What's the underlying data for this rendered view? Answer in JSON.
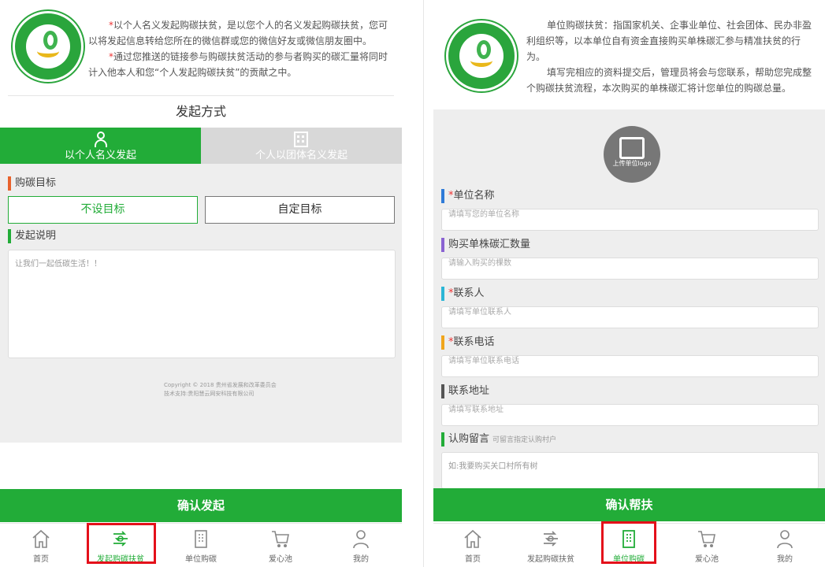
{
  "left": {
    "intro": [
      {
        "star": "*",
        "text": "以个人名义发起购碳扶贫，是以您个人的名义发起购碳扶贫，您可以将发起信息转给您所在的微信群或您的微信好友或微信朋友圈中。"
      },
      {
        "star": "*",
        "text": "通过您推送的链接参与购碳扶贫活动的参与者购买的碳汇量将同时计入他本人和您“个人发起购碳扶贫”的贡献之中。"
      }
    ],
    "section_title": "发起方式",
    "mode_tabs": [
      {
        "label": "以个人名义发起",
        "icon": "person-icon"
      },
      {
        "label": "个人以团体名义发起",
        "icon": "building-icon"
      }
    ],
    "goal_label": "购碳目标",
    "goal_buttons": [
      "不设目标",
      "自定目标"
    ],
    "desc_label": "发起说明",
    "desc_placeholder": "让我们一起低碳生活！！",
    "footer": {
      "copyright": "Copyright © 2018 贵州省发展和改革委员会",
      "support": "技术支持:贵阳慧云网安科技有限公司"
    },
    "confirm": "确认发起",
    "colors": {
      "accent": "#22ac38",
      "bar_goal": "#e8622c",
      "bar_desc": "#22ac38"
    }
  },
  "right": {
    "intro": [
      {
        "text": "单位购碳扶贫：指国家机关、企事业单位、社会团体、民办非盈利组织等，以本单位自有资金直接购买单株碳汇参与精准扶贫的行为。"
      },
      {
        "text": "填写完相应的资料提交后，管理员将会与您联系，帮助您完成整个购碳扶贫流程，本次购买的单株碳汇将计您单位的购碳总量。"
      }
    ],
    "upload_label": "上传单位logo",
    "fields": [
      {
        "label": "单位名称",
        "required": "*",
        "placeholder": "请填写您的单位名称",
        "bar": "#2f7bd8"
      },
      {
        "label": "购买单株碳汇数量",
        "required": "",
        "placeholder": "请输入购买的棵数",
        "bar": "#8a63d2"
      },
      {
        "label": "联系人",
        "required": "*",
        "placeholder": "请填写单位联系人",
        "bar": "#2bb6d6"
      },
      {
        "label": "联系电话",
        "required": "*",
        "placeholder": "请填写单位联系电话",
        "bar": "#f0a51c"
      },
      {
        "label": "联系地址",
        "required": "",
        "placeholder": "请填写联系地址",
        "bar": "#555555"
      }
    ],
    "message_label": "认购留言",
    "message_hint": "可留言指定认购村户",
    "message_placeholder": "如:我要购买关口村所有树",
    "confirm": "确认帮扶"
  },
  "nav": [
    {
      "label": "首页",
      "icon": "home-icon"
    },
    {
      "label": "发起购碳扶贫",
      "icon": "carbon-launch-icon"
    },
    {
      "label": "单位购碳",
      "icon": "building-icon"
    },
    {
      "label": "爱心池",
      "icon": "cart-icon"
    },
    {
      "label": "我的",
      "icon": "user-icon"
    }
  ]
}
